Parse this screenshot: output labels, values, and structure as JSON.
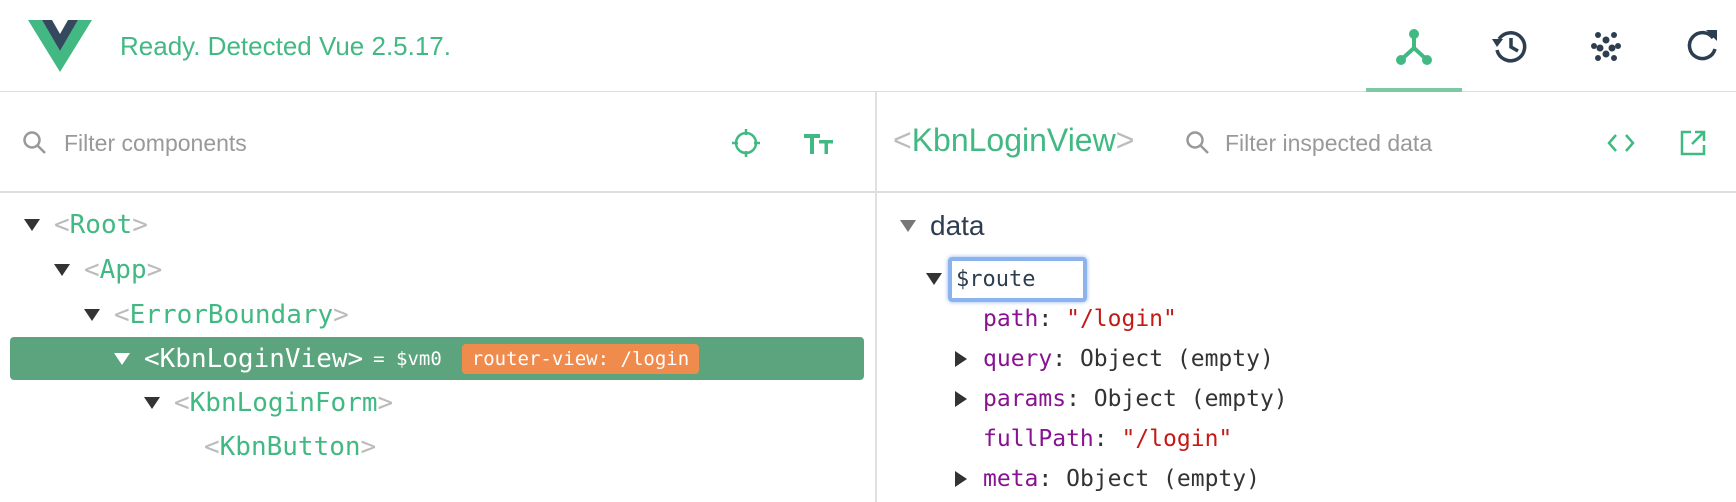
{
  "header": {
    "status": "Ready. Detected Vue 2.5.17.",
    "tabs": [
      {
        "icon": "components-icon",
        "active": true
      },
      {
        "icon": "history-icon",
        "active": false
      },
      {
        "icon": "vuex-icon",
        "active": false
      },
      {
        "icon": "refresh-icon",
        "active": false
      }
    ]
  },
  "components_panel": {
    "filter_placeholder": "Filter components",
    "tree": [
      {
        "name": "Root",
        "depth": 0,
        "expanded": true
      },
      {
        "name": "App",
        "depth": 1,
        "expanded": true
      },
      {
        "name": "ErrorBoundary",
        "depth": 2,
        "expanded": true
      },
      {
        "name": "KbnLoginView",
        "depth": 3,
        "expanded": true,
        "selected": true,
        "vm_ref": "= $vm0",
        "badge": "router-view: /login"
      },
      {
        "name": "KbnLoginForm",
        "depth": 4,
        "expanded": true
      },
      {
        "name": "KbnButton",
        "depth": 5,
        "expanded": false
      }
    ]
  },
  "inspector": {
    "component_name": "KbnLoginView",
    "filter_placeholder": "Filter inspected data",
    "section": "data",
    "route_key": "$route",
    "props": [
      {
        "key": "path",
        "value": "\"/login\"",
        "type": "string",
        "expandable": false
      },
      {
        "key": "query",
        "value": "Object (empty)",
        "type": "object",
        "expandable": true
      },
      {
        "key": "params",
        "value": "Object (empty)",
        "type": "object",
        "expandable": true
      },
      {
        "key": "fullPath",
        "value": "\"/login\"",
        "type": "string",
        "expandable": false
      },
      {
        "key": "meta",
        "value": "Object (empty)",
        "type": "object",
        "expandable": true
      }
    ]
  },
  "colors": {
    "accent": "#42b983",
    "selected_row": "#5ba47d",
    "badge": "#f08b4e"
  }
}
